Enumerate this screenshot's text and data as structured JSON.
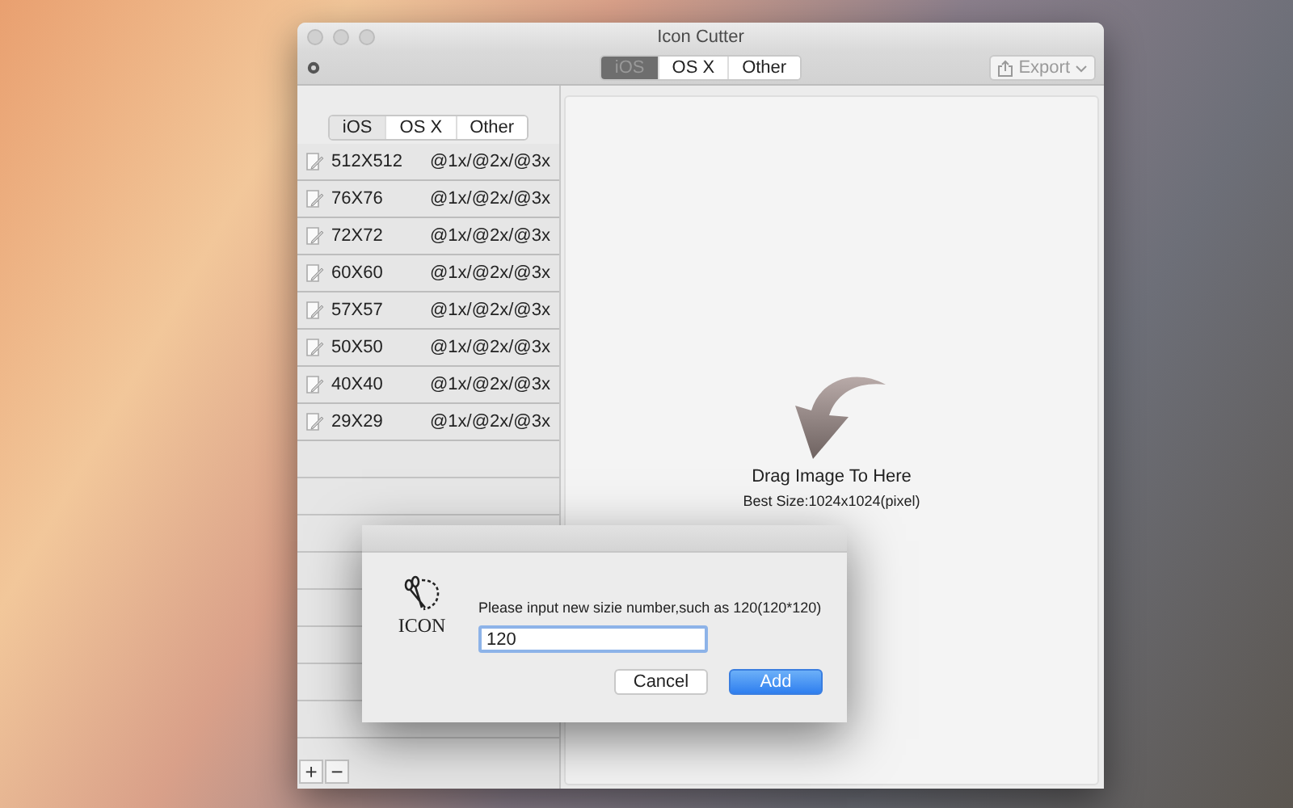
{
  "window": {
    "title": "Icon Cutter"
  },
  "toolbar": {
    "tabs": [
      {
        "label": "iOS",
        "selected": true
      },
      {
        "label": "OS X",
        "selected": false
      },
      {
        "label": "Other",
        "selected": false
      }
    ],
    "export": {
      "label": "Export",
      "disabled": true
    }
  },
  "sidebar": {
    "tabs": [
      {
        "label": "iOS",
        "selected": true
      },
      {
        "label": "OS X",
        "selected": false
      },
      {
        "label": "Other",
        "selected": false
      }
    ],
    "rows": [
      {
        "size": "512X512",
        "scales": "@1x/@2x/@3x"
      },
      {
        "size": "76X76",
        "scales": "@1x/@2x/@3x"
      },
      {
        "size": "72X72",
        "scales": "@1x/@2x/@3x"
      },
      {
        "size": "60X60",
        "scales": "@1x/@2x/@3x"
      },
      {
        "size": "57X57",
        "scales": "@1x/@2x/@3x"
      },
      {
        "size": "50X50",
        "scales": "@1x/@2x/@3x"
      },
      {
        "size": "40X40",
        "scales": "@1x/@2x/@3x"
      },
      {
        "size": "29X29",
        "scales": "@1x/@2x/@3x"
      }
    ],
    "buttons": [
      "+",
      "−"
    ]
  },
  "drop_zone": {
    "title": "Drag Image To Here",
    "hint": "Best Size:1024x1024(pixel)"
  },
  "dialog": {
    "logo_text": "ICON",
    "message": "Please input new sizie number,such as 120(120*120)",
    "value": "120",
    "buttons": [
      {
        "label": "Cancel",
        "default": false
      },
      {
        "label": "Add",
        "default": true
      }
    ]
  }
}
